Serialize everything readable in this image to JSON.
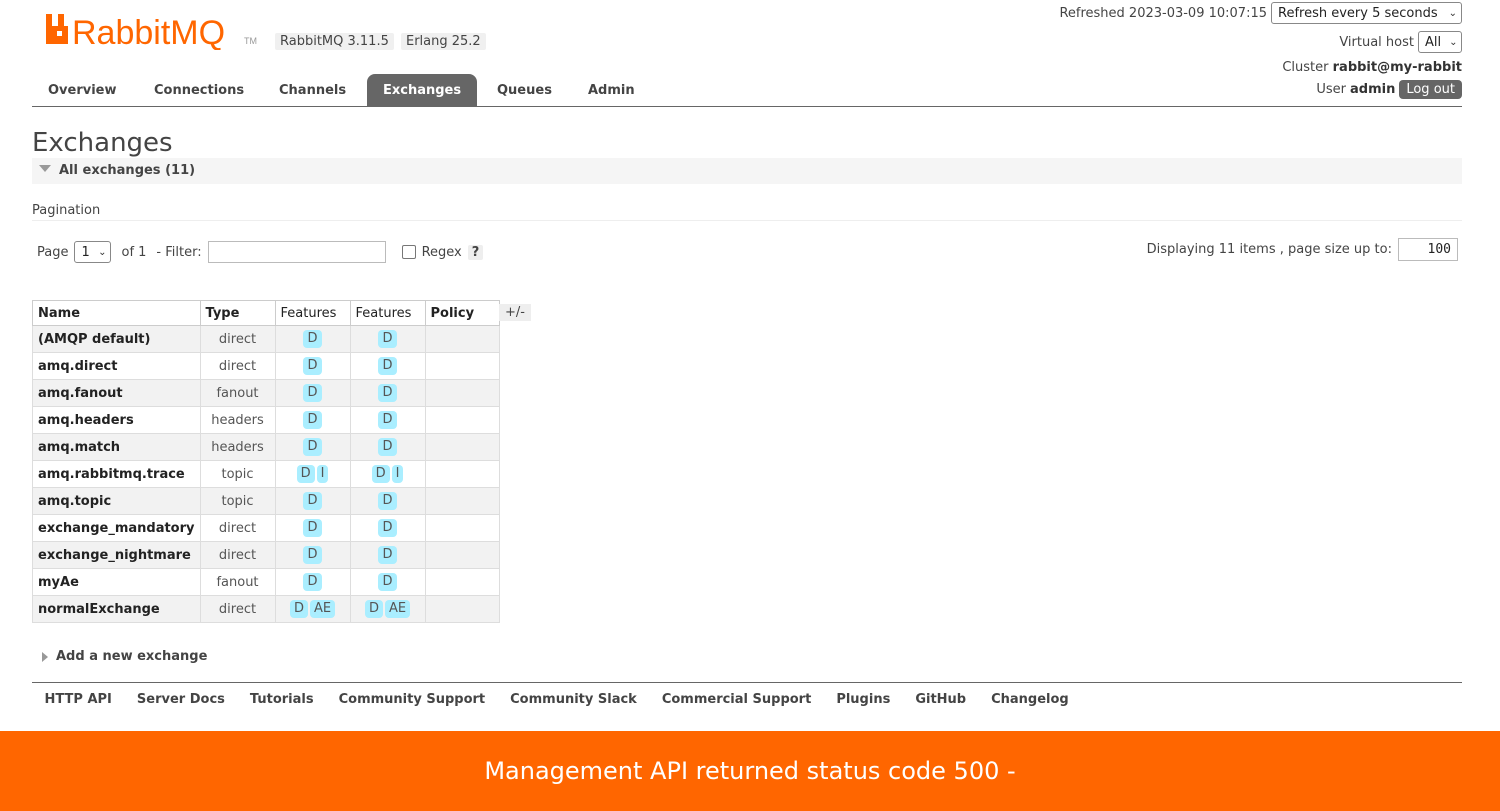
{
  "brand": {
    "name": "RabbitMQ",
    "tm": "TM",
    "color": "#ff6600"
  },
  "versions": {
    "rabbitmq": "RabbitMQ 3.11.5",
    "erlang": "Erlang 25.2"
  },
  "header": {
    "refreshed_label": "Refreshed 2023-03-09 10:07:15",
    "refresh_select": "Refresh every 5 seconds",
    "vhost_label": "Virtual host",
    "vhost_select": "All",
    "cluster_label": "Cluster",
    "cluster_value": "rabbit@my-rabbit",
    "user_label": "User",
    "user_value": "admin",
    "logout": "Log out"
  },
  "nav": {
    "tabs": [
      {
        "label": "Overview"
      },
      {
        "label": "Connections"
      },
      {
        "label": "Channels"
      },
      {
        "label": "Exchanges"
      },
      {
        "label": "Queues"
      },
      {
        "label": "Admin"
      }
    ],
    "active": "Exchanges"
  },
  "page": {
    "title": "Exchanges",
    "section_label": "All exchanges (11)",
    "pagination_label": "Pagination",
    "page_label": "Page",
    "page_value": "1",
    "of_label": "of 1",
    "filter_label": "- Filter:",
    "filter_value": "",
    "regex_label": "Regex",
    "help": "?",
    "display_label": "Displaying 11 items , page size up to:",
    "page_size": "100"
  },
  "table": {
    "headers": [
      "Name",
      "Type",
      "Features",
      "Features",
      "Policy"
    ],
    "toggle_columns": "+/-",
    "rows": [
      {
        "name": "(AMQP default)",
        "type": "direct",
        "features": [
          "D"
        ],
        "features2": [
          "D"
        ],
        "policy": ""
      },
      {
        "name": "amq.direct",
        "type": "direct",
        "features": [
          "D"
        ],
        "features2": [
          "D"
        ],
        "policy": ""
      },
      {
        "name": "amq.fanout",
        "type": "fanout",
        "features": [
          "D"
        ],
        "features2": [
          "D"
        ],
        "policy": ""
      },
      {
        "name": "amq.headers",
        "type": "headers",
        "features": [
          "D"
        ],
        "features2": [
          "D"
        ],
        "policy": ""
      },
      {
        "name": "amq.match",
        "type": "headers",
        "features": [
          "D"
        ],
        "features2": [
          "D"
        ],
        "policy": ""
      },
      {
        "name": "amq.rabbitmq.trace",
        "type": "topic",
        "features": [
          "D",
          "I"
        ],
        "features2": [
          "D",
          "I"
        ],
        "policy": ""
      },
      {
        "name": "amq.topic",
        "type": "topic",
        "features": [
          "D"
        ],
        "features2": [
          "D"
        ],
        "policy": ""
      },
      {
        "name": "exchange_mandatory",
        "type": "direct",
        "features": [
          "D"
        ],
        "features2": [
          "D"
        ],
        "policy": ""
      },
      {
        "name": "exchange_nightmare",
        "type": "direct",
        "features": [
          "D"
        ],
        "features2": [
          "D"
        ],
        "policy": ""
      },
      {
        "name": "myAe",
        "type": "fanout",
        "features": [
          "D"
        ],
        "features2": [
          "D"
        ],
        "policy": ""
      },
      {
        "name": "normalExchange",
        "type": "direct",
        "features": [
          "D",
          "AE"
        ],
        "features2": [
          "D",
          "AE"
        ],
        "policy": ""
      }
    ]
  },
  "add_exchange": "Add a new exchange",
  "footer": {
    "links": [
      {
        "label": "HTTP API"
      },
      {
        "label": "Server Docs"
      },
      {
        "label": "Tutorials"
      },
      {
        "label": "Community Support"
      },
      {
        "label": "Community Slack"
      },
      {
        "label": "Commercial Support"
      },
      {
        "label": "Plugins"
      },
      {
        "label": "GitHub"
      },
      {
        "label": "Changelog"
      }
    ]
  },
  "error_banner": "Management API returned status code 500 -",
  "colors": {
    "tag_bg": "#aaeeff",
    "active_tab": "#666666",
    "error_bg": "#ff6600"
  }
}
